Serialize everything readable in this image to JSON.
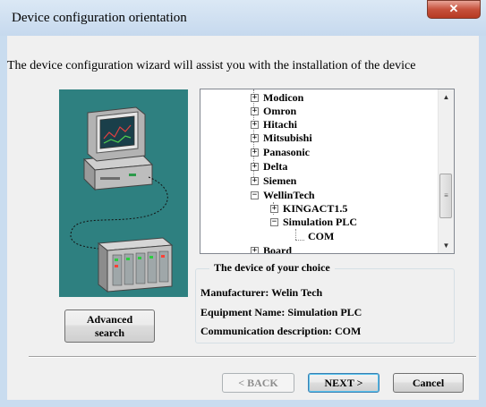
{
  "window": {
    "title": "Device configuration orientation",
    "close_symbol": "✕"
  },
  "intro_text": "The device configuration wizard will assist you with the installation of the device",
  "device_tree": {
    "items": [
      {
        "label": "Modicon",
        "expander": "+"
      },
      {
        "label": "Omron",
        "expander": "+"
      },
      {
        "label": "Hitachi",
        "expander": "+"
      },
      {
        "label": "Mitsubishi",
        "expander": "+"
      },
      {
        "label": "Panasonic",
        "expander": "+"
      },
      {
        "label": "Delta",
        "expander": "+"
      },
      {
        "label": "Siemen",
        "expander": "+"
      },
      {
        "label": "WellinTech",
        "expander": "−"
      },
      {
        "label": "KINGACT1.5",
        "expander": "+"
      },
      {
        "label": "Simulation  PLC",
        "expander": "−"
      },
      {
        "label": "COM",
        "expander": ""
      },
      {
        "label": "Board",
        "expander": "+"
      }
    ],
    "scroll_up": "▲",
    "scroll_down": "▼"
  },
  "advanced_search": {
    "line1": "Advanced",
    "line2": "search"
  },
  "choice": {
    "legend": "The device of your choice",
    "manufacturer": "Manufacturer:  Welin Tech",
    "equipment": "Equipment Name:  Simulation  PLC",
    "communication": "Communication description:  COM"
  },
  "buttons": {
    "back": "<  BACK",
    "next": "NEXT  >",
    "cancel": "Cancel"
  },
  "colors": {
    "picture_bg": "#2e8080",
    "client_bg": "#f0f0f0",
    "close_red": "#c6513c"
  }
}
